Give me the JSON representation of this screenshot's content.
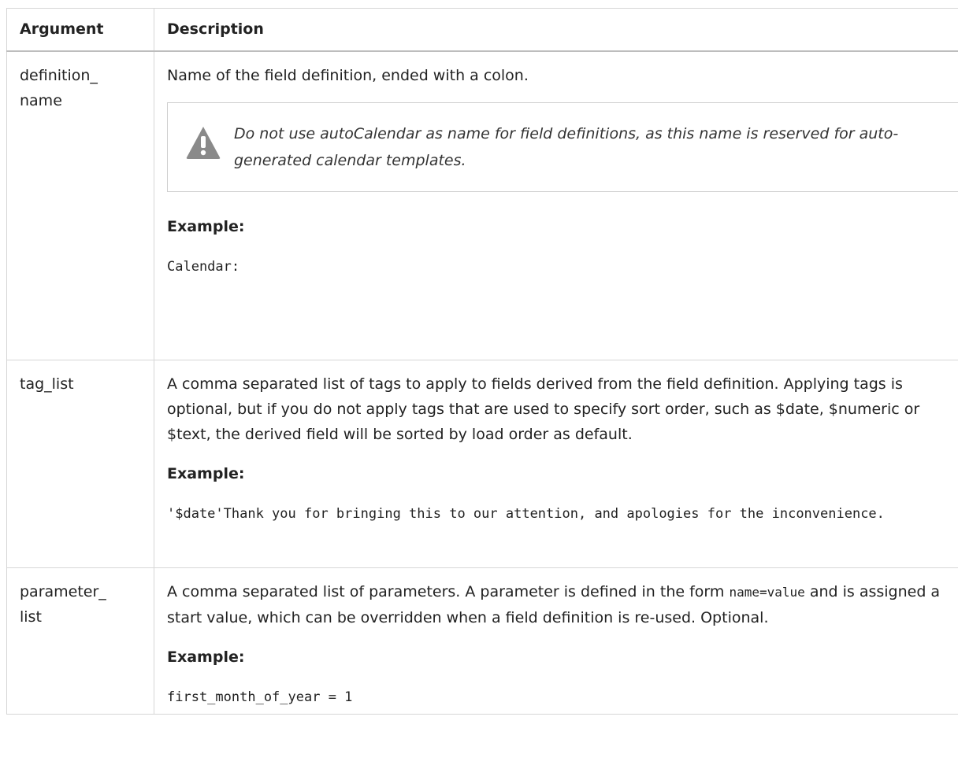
{
  "table": {
    "headers": {
      "argument": "Argument",
      "description": "Description"
    },
    "rows": [
      {
        "argument": "definition_ name",
        "description": "Name of the field definition, ended with a colon.",
        "note": "Do not use autoCalendar as name for field definitions, as this name is reserved for auto-generated calendar templates.",
        "example_label": "Example:",
        "example_code": "Calendar:"
      },
      {
        "argument": "tag_list",
        "description": "A comma separated list of tags to apply to fields derived from the field definition. Applying tags is optional, but if you do not apply tags that are used to specify sort order, such as $date, $numeric or $text, the derived field will be sorted by load order as default.",
        "example_label": "Example:",
        "example_code": "'$date'Thank you for bringing this to our attention, and apologies for the inconvenience."
      },
      {
        "argument": "parameter_ list",
        "description_before": "A comma separated list of parameters. A parameter is defined in the form ",
        "description_code": "name=value",
        "description_after": " and is assigned a start value, which can be overridden when a field definition is re-used. Optional.",
        "example_label": "Example:",
        "example_code": "first_month_of_year = 1"
      }
    ]
  },
  "icons": {
    "note": "warning-icon"
  },
  "colors": {
    "border": "#d6d6d6",
    "warning_icon": "#8a8a8a"
  }
}
